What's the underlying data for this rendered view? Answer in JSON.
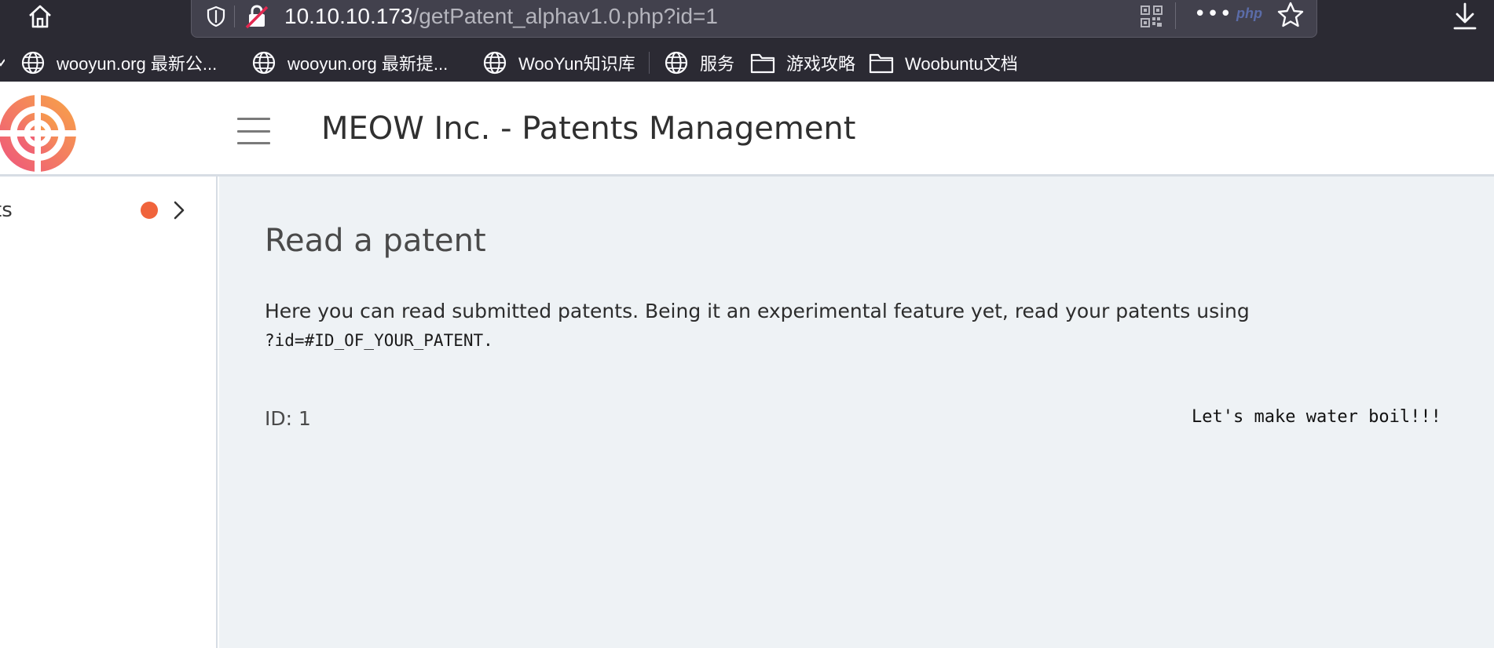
{
  "browser": {
    "url_host": "10.10.10.173",
    "url_path": "/getPatent_alphav1.0.php?id=1",
    "php_badge": "php",
    "more_label": "•••",
    "bookmarks": [
      {
        "label": "wooyun.org 最新公...",
        "icon": "globe-icon"
      },
      {
        "label": "wooyun.org 最新提...",
        "icon": "globe-icon"
      },
      {
        "label": "WooYun知识库",
        "icon": "globe-icon"
      },
      {
        "label": "服务",
        "icon": "globe-icon"
      },
      {
        "label": "游戏攻略",
        "icon": "folder-icon"
      },
      {
        "label": "Woobuntu文档",
        "icon": "folder-icon"
      }
    ]
  },
  "header": {
    "title": "MEOW Inc. - Patents Management"
  },
  "sidebar": {
    "items": [
      {
        "label": "ts",
        "badge_color": "#f0643c"
      }
    ]
  },
  "main": {
    "heading": "Read a patent",
    "description": "Here you can read submitted patents. Being it an experimental feature yet, read your patents using",
    "description_code": "?id=#ID_OF_YOUR_PATENT.",
    "patent": {
      "id_label": "ID: 1",
      "text": "Let's make water boil!!!"
    }
  },
  "colors": {
    "browser_bg": "#2b2a33",
    "content_bg": "#eef2f5",
    "accent": "#f0643c",
    "logo_pink": "#ef5a7a",
    "logo_orange": "#f7a04a"
  }
}
